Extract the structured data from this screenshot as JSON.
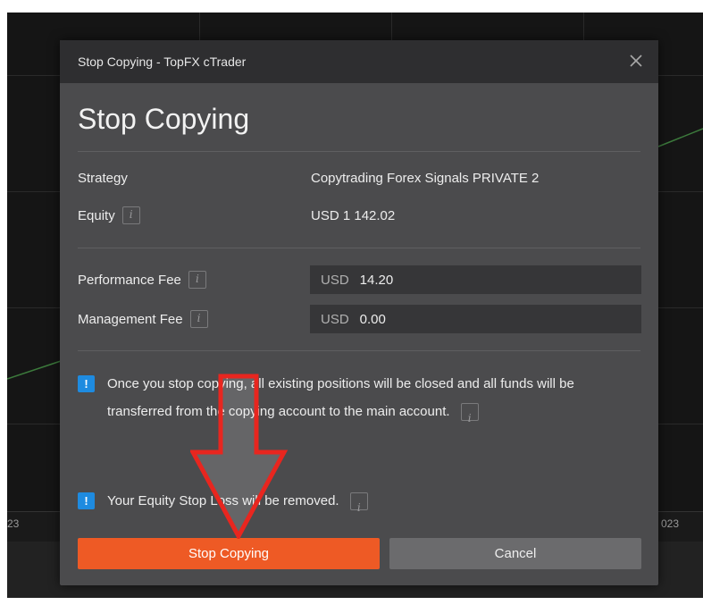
{
  "background": {
    "axis_left_label": "23",
    "axis_right_label": "023"
  },
  "dialog": {
    "window_title": "Stop Copying - TopFX cTrader",
    "heading": "Stop Copying",
    "strategy_label": "Strategy",
    "strategy_value": "Copytrading Forex Signals PRIVATE 2",
    "equity_label": "Equity",
    "equity_value": "USD 1 142.02",
    "performance_fee_label": "Performance Fee",
    "performance_fee_currency": "USD",
    "performance_fee_value": "14.20",
    "management_fee_label": "Management Fee",
    "management_fee_currency": "USD",
    "management_fee_value": "0.00",
    "notice1_text": "Once you stop copying, all existing positions will be closed and all funds will be transferred from the copying account to the main account.",
    "notice2_text": "Your Equity Stop Loss will be removed.",
    "badge_glyph": "!",
    "stop_button_label": "Stop Copying",
    "cancel_button_label": "Cancel"
  },
  "colors": {
    "accent": "#ee5a25",
    "info_badge": "#1e8be0",
    "annotation_arrow": "#e8261f"
  },
  "icons": [
    "close-icon",
    "info-icon",
    "exclamation-icon",
    "red-arrow-annotation"
  ]
}
